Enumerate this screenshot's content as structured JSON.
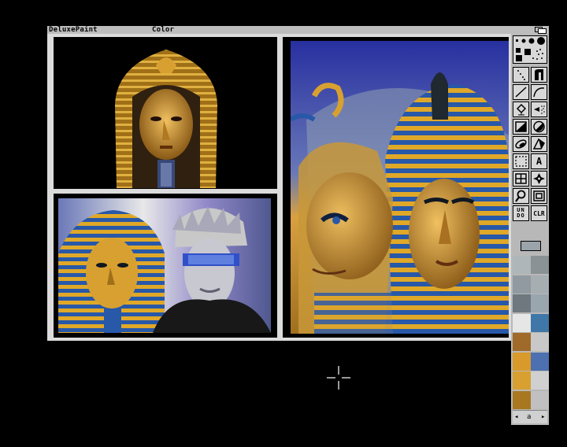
{
  "titlebar": {
    "app_name": "DeluxePaint",
    "menu_item": "Color"
  },
  "toolbox": {
    "tools": [
      {
        "name": "brush-size-icon"
      },
      {
        "name": "brush-size-icon"
      },
      {
        "name": "dotted-freehand-icon",
        "label": ""
      },
      {
        "name": "continuous-freehand-icon",
        "label": ""
      },
      {
        "name": "straight-line-icon",
        "label": ""
      },
      {
        "name": "curve-icon",
        "label": ""
      },
      {
        "name": "fill-icon",
        "label": ""
      },
      {
        "name": "airbrush-icon",
        "label": ""
      },
      {
        "name": "rectangle-icon",
        "label": ""
      },
      {
        "name": "circle-icon",
        "label": ""
      },
      {
        "name": "ellipse-icon",
        "label": ""
      },
      {
        "name": "polygon-icon",
        "label": ""
      },
      {
        "name": "brush-select-icon",
        "label": ""
      },
      {
        "name": "text-tool",
        "label": "A"
      },
      {
        "name": "grid-icon",
        "label": ""
      },
      {
        "name": "symmetry-icon",
        "label": ""
      },
      {
        "name": "magnify-icon",
        "label": ""
      },
      {
        "name": "zoom-icon",
        "label": ""
      },
      {
        "name": "undo-button",
        "label": "UN DO"
      },
      {
        "name": "clear-button",
        "label": "CLR"
      }
    ],
    "palette_left": [
      "#aeb6ba",
      "#909aa0",
      "#6e787e",
      "#e6e6e6",
      "#a06a2a",
      "#d89a2a",
      "#d8a030",
      "#a87820"
    ],
    "palette_right": [
      "#8a9296",
      "#a6aeb2",
      "#9aa6ae",
      "#3f78a8",
      "#c8c8c8",
      "#4c70b0",
      "#d0d0d0",
      "#c0c0c0"
    ],
    "palette_nav": {
      "left": "◂",
      "middle": "a",
      "right": "▸"
    },
    "colors": {
      "titlebar": "#bdbdbd",
      "canvas_frame": "#dcdcdc",
      "toolbox_bg": "#b8b8b8"
    }
  },
  "canvas": {
    "images": [
      {
        "name": "tutankhamun-mask-portrait",
        "caption": ""
      },
      {
        "name": "pharaoh-and-punk-portrait",
        "caption": ""
      },
      {
        "name": "double-pharaoh-profile",
        "caption": ""
      }
    ]
  }
}
